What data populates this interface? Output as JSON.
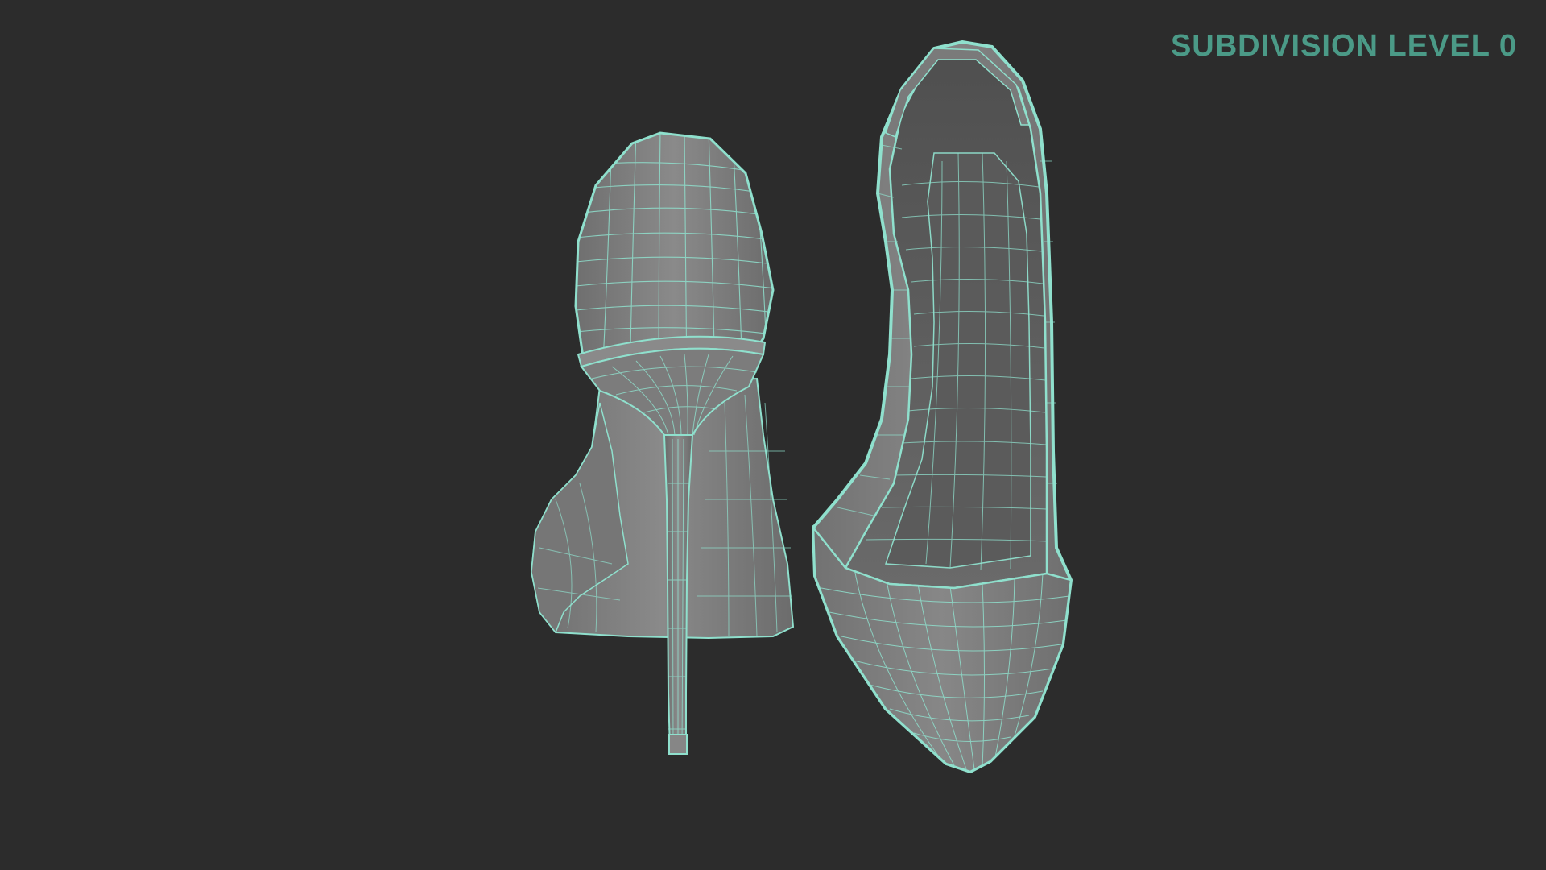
{
  "overlay": {
    "label": "SUBDIVISION LEVEL 0"
  },
  "colors": {
    "background": "#2c2c2c",
    "label": "#4b9a87",
    "mesh_surface": "#7e7e7e",
    "mesh_inner": "#646464",
    "wire": "#8fe0cd"
  },
  "scene": {
    "objects": [
      "high-heel-shoe-back-view",
      "high-heel-shoe-top-view"
    ],
    "display_mode": "wireframe-on-shaded"
  }
}
